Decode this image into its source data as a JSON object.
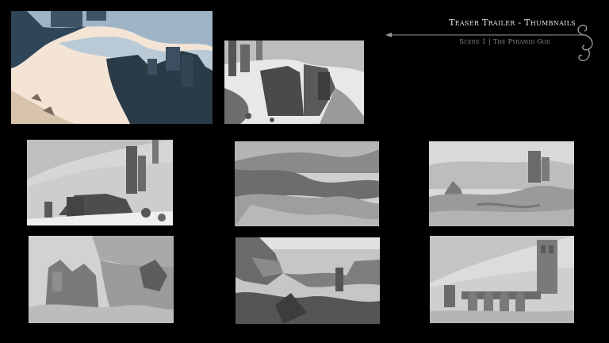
{
  "header": {
    "title": "Teaser Trailer - Thumbnails",
    "subtitle": "Scene 1 | The Pyramid God",
    "icons": [
      "arrow-rule",
      "ornamental-flourish"
    ]
  },
  "colors": {
    "background": "#000000",
    "title_text": "#e6e6e6",
    "subtitle_text": "#8c8c8c",
    "sky_blue": "#9bb3c6",
    "sand": "#f3e6d8"
  },
  "thumbnails": [
    {
      "name": "color-keyframe",
      "tone": "color"
    },
    {
      "name": "ruins-courtyard",
      "tone": "grayscale"
    },
    {
      "name": "tower-on-hill",
      "tone": "grayscale"
    },
    {
      "name": "rolling-dunes",
      "tone": "grayscale"
    },
    {
      "name": "distant-ruin",
      "tone": "grayscale"
    },
    {
      "name": "cliff-fortress",
      "tone": "grayscale"
    },
    {
      "name": "canyon-bridge",
      "tone": "grayscale"
    },
    {
      "name": "aqueduct-tower",
      "tone": "grayscale"
    }
  ]
}
